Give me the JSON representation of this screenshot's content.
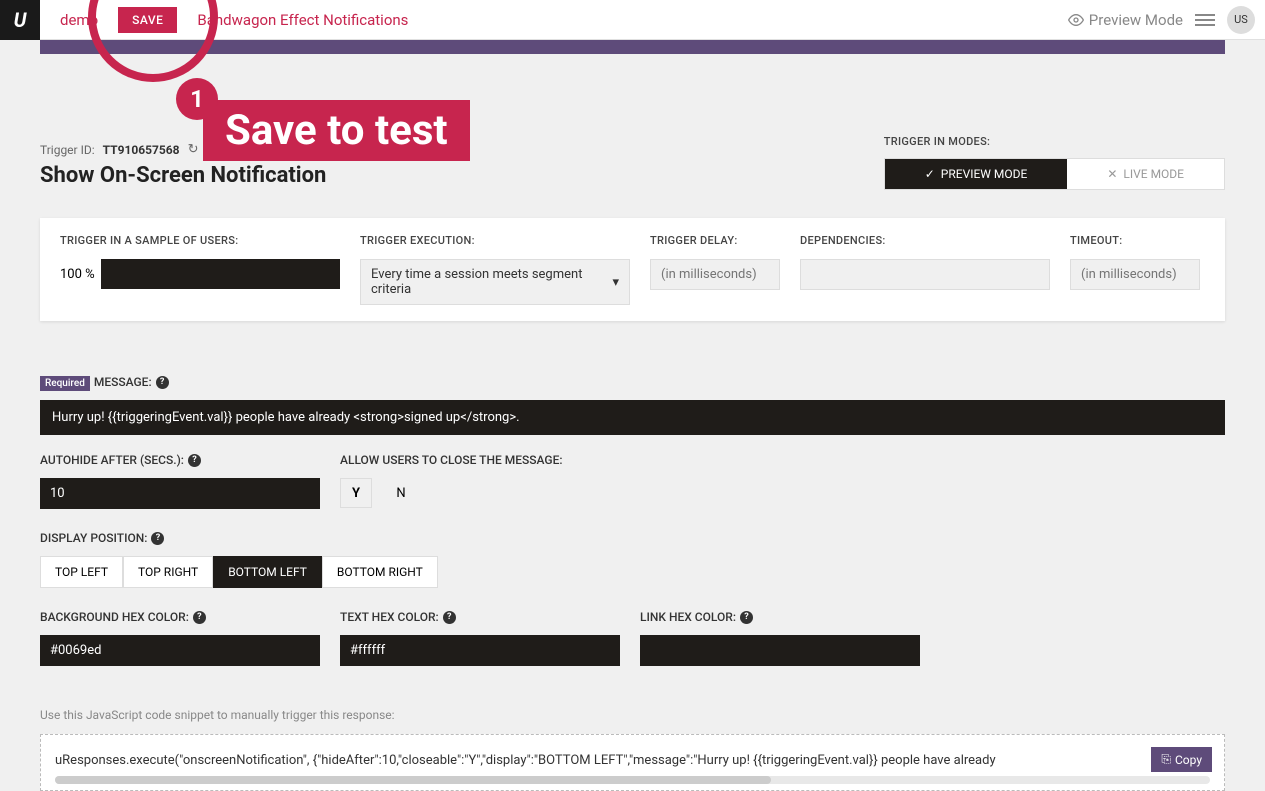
{
  "header": {
    "brand": "demo",
    "save": "SAVE",
    "title": "Bandwagon Effect Notifications",
    "previewMode": "Preview Mode",
    "user": "US"
  },
  "callout": {
    "num": "1",
    "text": "Save to test"
  },
  "trigger": {
    "idLabel": "Trigger ID:",
    "idValue": "TT910657568",
    "heading": "Show On-Screen Notification"
  },
  "modes": {
    "label": "TRIGGER IN MODES:",
    "preview": "PREVIEW MODE",
    "live": "LIVE MODE"
  },
  "config": {
    "sampleLabel": "TRIGGER IN A SAMPLE OF USERS:",
    "samplePct": "100 %",
    "execLabel": "TRIGGER EXECUTION:",
    "execValue": "Every time a session meets segment criteria",
    "delayLabel": "TRIGGER DELAY:",
    "delayPlaceholder": "(in milliseconds)",
    "depsLabel": "DEPENDENCIES:",
    "timeoutLabel": "TIMEOUT:",
    "timeoutPlaceholder": "(in milliseconds)"
  },
  "message": {
    "required": "Required",
    "label": "MESSAGE:",
    "value": "Hurry up! {{triggeringEvent.val}} people have already <strong>signed up</strong>.",
    "autohideLabel": "AUTOHIDE AFTER (SECS.):",
    "autohideValue": "10",
    "closeLabel": "ALLOW USERS TO CLOSE THE MESSAGE:",
    "y": "Y",
    "n": "N",
    "posLabel": "DISPLAY POSITION:",
    "posTL": "TOP LEFT",
    "posTR": "TOP RIGHT",
    "posBL": "BOTTOM LEFT",
    "posBR": "BOTTOM RIGHT",
    "bgLabel": "BACKGROUND HEX COLOR:",
    "bgValue": "#0069ed",
    "txtLabel": "TEXT HEX COLOR:",
    "txtValue": "#ffffff",
    "linkLabel": "LINK HEX COLOR:"
  },
  "snippet": {
    "label": "Use this JavaScript code snippet to manually trigger this response:",
    "code": "uResponses.execute(\"onscreenNotification\", {\"hideAfter\":10,\"closeable\":\"Y\",\"display\":\"BOTTOM LEFT\",\"message\":\"Hurry up! {{triggeringEvent.val}} people have already",
    "copy": "Copy"
  }
}
